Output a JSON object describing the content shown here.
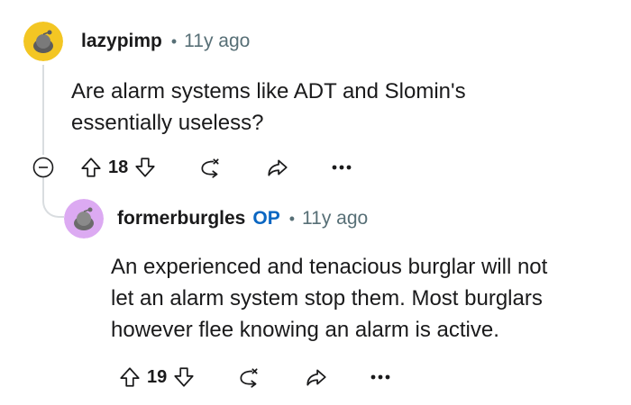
{
  "comments": [
    {
      "author": "lazypimp",
      "separator": "•",
      "time": "11y ago",
      "body": [
        "Are alarm systems like ADT and Slomin's",
        "essentially useless?"
      ],
      "votes": "18",
      "avatar_color": "#f3c623"
    },
    {
      "author": "formerburgles",
      "op_badge": "OP",
      "separator": "•",
      "time": "11y ago",
      "body": [
        "An experienced and tenacious burglar will not",
        "let an alarm system stop them. Most burglars",
        "however flee knowing an alarm is active."
      ],
      "votes": "19",
      "avatar_color": "#dcaaf2"
    }
  ],
  "icons": {
    "collapse": "minus-circle-icon",
    "upvote": "arrow-up-icon",
    "downvote": "arrow-down-icon",
    "award": "award-icon",
    "share": "share-icon",
    "more": "more-dots-icon"
  },
  "colors": {
    "op": "#0a66c2",
    "meta": "#576f76",
    "icon": "#1a1a1b"
  }
}
